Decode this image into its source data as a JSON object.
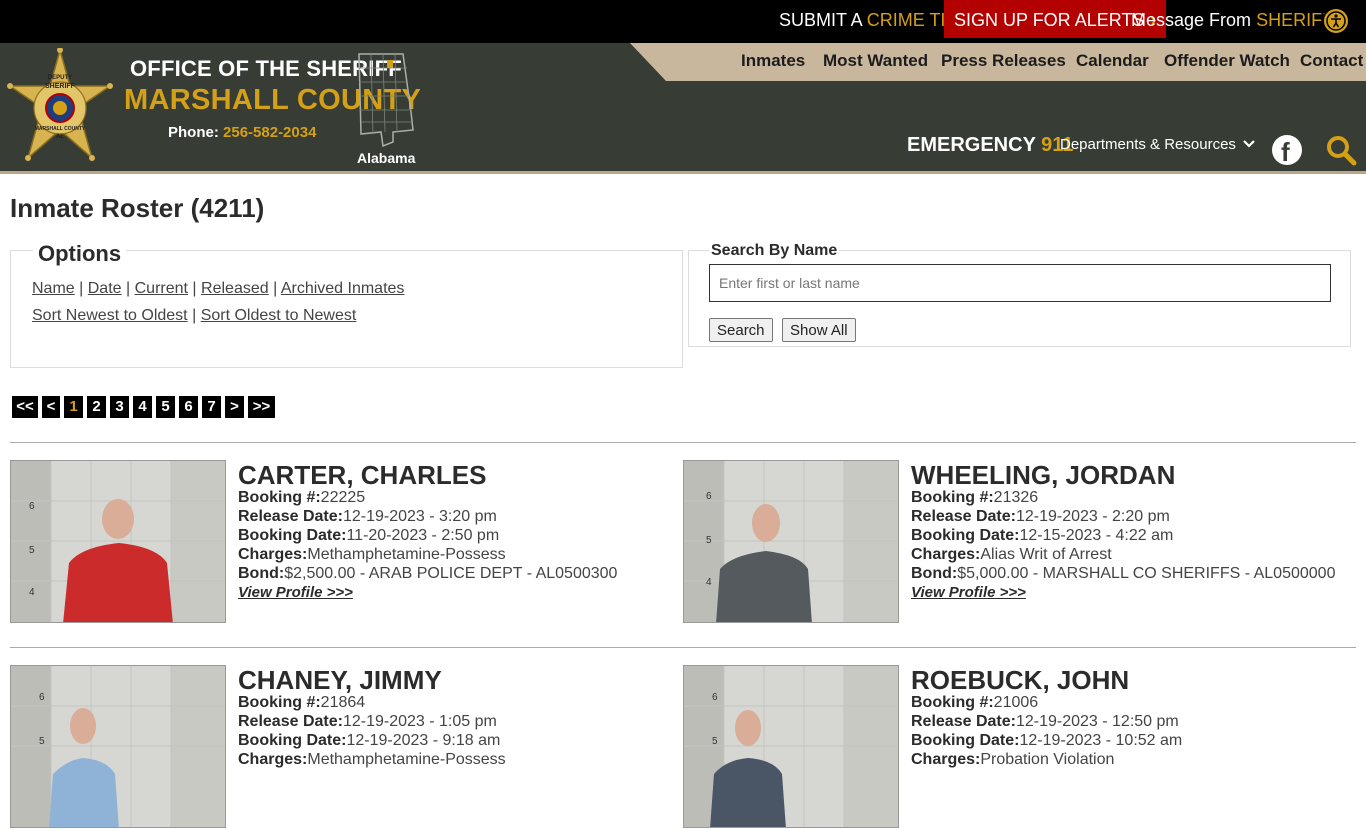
{
  "topbar": {
    "submit_prefix": "SUBMIT A",
    "submit_hl": "CRIME TIP",
    "alerts": "SIGN UP FOR ALERTS",
    "message_prefix": "Message From",
    "message_hl": "SHERIFF",
    "chev": "›"
  },
  "header": {
    "office": "OFFICE OF THE SHERIFF",
    "county": "MARSHALL COUNTY",
    "phone_label": "Phone:",
    "phone": "256-582-2034",
    "state": "Alabama",
    "emergency_label": "EMERGENCY",
    "emergency_num": "911",
    "departments": "Departments & Resources",
    "fb": "f",
    "badge_text": [
      "DEPUTY",
      "SHERIFF",
      "MARSHALL COUNTY",
      "AL"
    ]
  },
  "nav": [
    "Inmates",
    "Most Wanted",
    "Press Releases",
    "Calendar",
    "Offender Watch",
    "Contact"
  ],
  "page": {
    "title": "Inmate Roster (4211)"
  },
  "options": {
    "legend": "Options",
    "sort_links": [
      "Name",
      "Date",
      "Current",
      "Released",
      "Archived Inmates"
    ],
    "order_links": [
      "Sort Newest to Oldest",
      "Sort Oldest to Newest"
    ],
    "sep": "|"
  },
  "search": {
    "label": "Search By Name",
    "placeholder": "Enter first or last name",
    "search_btn": "Search",
    "showall_btn": "Show All"
  },
  "pagination": {
    "items": [
      "<<",
      "<",
      "1",
      "2",
      "3",
      "4",
      "5",
      "6",
      "7",
      ">",
      ">>"
    ],
    "active": "1"
  },
  "labels": {
    "booking": "Booking #:",
    "release": "Release Date:",
    "booking_date": "Booking Date:",
    "charges": "Charges:",
    "bond": "Bond:",
    "view": "View Profile >>>"
  },
  "inmates": [
    {
      "name": "CARTER, CHARLES",
      "booking": "22225",
      "release": "12-19-2023 - 3:20 pm",
      "booking_date": "11-20-2023 - 2:50 pm",
      "charges": "Methamphetamine-Possess",
      "bond": "$2,500.00 - ARAB POLICE DEPT - AL0500300",
      "shirt": "#cc2b2b"
    },
    {
      "name": "WHEELING, JORDAN",
      "booking": "21326",
      "release": "12-19-2023 - 2:20 pm",
      "booking_date": "12-15-2023 - 4:22 am",
      "charges": "Alias Writ of Arrest",
      "bond": "$5,000.00 - MARSHALL CO SHERIFFS - AL0500000",
      "shirt": "#555a5e"
    },
    {
      "name": "CHANEY, JIMMY",
      "booking": "21864",
      "release": "12-19-2023 - 1:05 pm",
      "booking_date": "12-19-2023 - 9:18 am",
      "charges": "Methamphetamine-Possess",
      "shirt": "#8fb3d6"
    },
    {
      "name": "ROEBUCK, JOHN",
      "booking": "21006",
      "release": "12-19-2023 - 12:50 pm",
      "booking_date": "12-19-2023 - 10:52 am",
      "charges": "Probation Violation",
      "shirt": "#4a5566"
    }
  ],
  "height_ruler": [
    "6",
    "5",
    "4"
  ]
}
